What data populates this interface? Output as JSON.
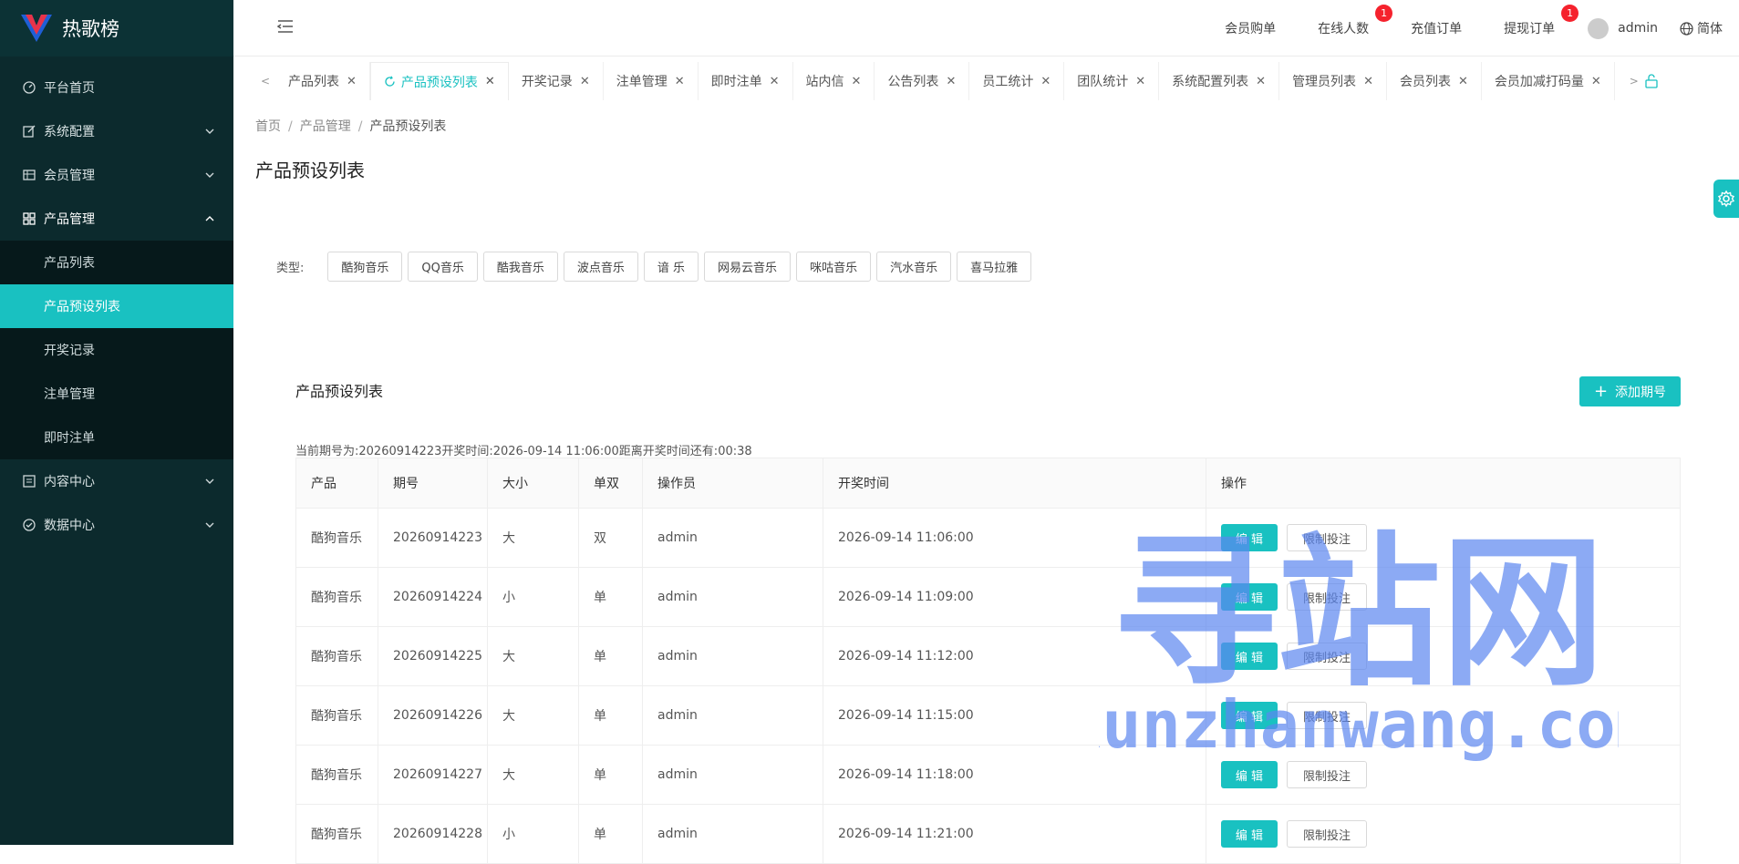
{
  "app": {
    "title": "热歌榜",
    "brand_color": "#19c1c1"
  },
  "sidebar": {
    "items": [
      {
        "label": "平台首页",
        "icon": "dashboard-icon"
      },
      {
        "label": "系统配置",
        "icon": "edit-icon"
      },
      {
        "label": "会员管理",
        "icon": "table-icon"
      },
      {
        "label": "产品管理",
        "icon": "grid-icon"
      },
      {
        "label": "内容中心",
        "icon": "document-icon"
      },
      {
        "label": "数据中心",
        "icon": "check-circle-icon"
      }
    ],
    "submenu": [
      {
        "label": "产品列表"
      },
      {
        "label": "产品预设列表"
      },
      {
        "label": "开奖记录"
      },
      {
        "label": "注单管理"
      },
      {
        "label": "即时注单"
      }
    ]
  },
  "topbar": {
    "links": [
      {
        "label": "会员购单"
      },
      {
        "label": "在线人数",
        "badge": "1"
      },
      {
        "label": "充值订单"
      },
      {
        "label": "提现订单",
        "badge": "1"
      }
    ],
    "user": "admin",
    "lang": "简体"
  },
  "tabs": [
    "产品列表",
    "产品预设列表",
    "开奖记录",
    "注单管理",
    "即时注单",
    "站内信",
    "公告列表",
    "员工统计",
    "团队统计",
    "系统配置列表",
    "管理员列表",
    "会员列表",
    "会员加减打码量"
  ],
  "breadcrumb": {
    "home": "首页",
    "section": "产品管理",
    "current": "产品预设列表"
  },
  "page_title": "产品预设列表",
  "filter": {
    "label": "类型:",
    "options": [
      "酷狗音乐",
      "QQ音乐",
      "酷我音乐",
      "波点音乐",
      "谙 乐",
      "网易云音乐",
      "咪咕音乐",
      "汽水音乐",
      "喜马拉雅"
    ]
  },
  "list": {
    "title": "产品预设列表",
    "add_label": "添加期号",
    "current_info": "当前期号为:20260914223开奖时间:2026-09-14 11:06:00距离开奖时间还有:00:38",
    "columns": [
      "产品",
      "期号",
      "大小",
      "单双",
      "操作员",
      "开奖时间",
      "操作"
    ],
    "rows": [
      [
        "酷狗音乐",
        "20260914223",
        "大",
        "双",
        "admin",
        "2026-09-14 11:06:00"
      ],
      [
        "酷狗音乐",
        "20260914224",
        "小",
        "单",
        "admin",
        "2026-09-14 11:09:00"
      ],
      [
        "酷狗音乐",
        "20260914225",
        "大",
        "单",
        "admin",
        "2026-09-14 11:12:00"
      ],
      [
        "酷狗音乐",
        "20260914226",
        "大",
        "单",
        "admin",
        "2026-09-14 11:15:00"
      ],
      [
        "酷狗音乐",
        "20260914227",
        "大",
        "单",
        "admin",
        "2026-09-14 11:18:00"
      ],
      [
        "酷狗音乐",
        "20260914228",
        "小",
        "单",
        "admin",
        "2026-09-14 11:21:00"
      ]
    ],
    "edit_label": "编 辑",
    "limit_label": "限制投注"
  },
  "watermark": {
    "title": "寻站网",
    "url": "xunzhanwang.com",
    "color": "#5b86f0"
  }
}
